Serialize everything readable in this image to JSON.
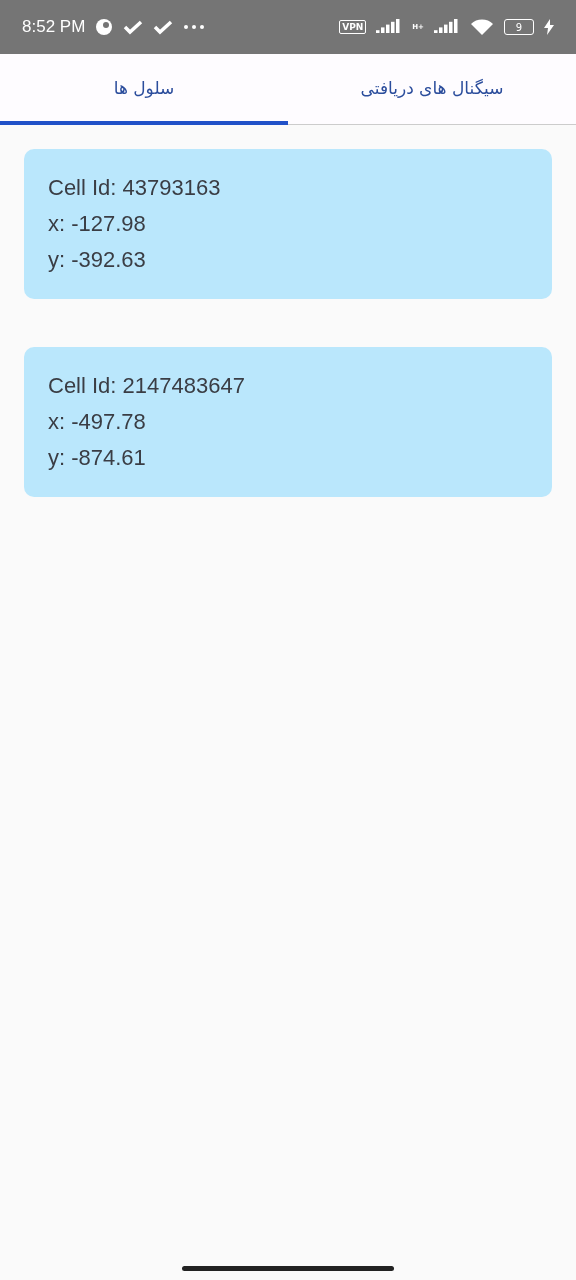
{
  "status_bar": {
    "time": "8:52 PM",
    "vpn": "VPN",
    "network": "H+",
    "battery": "9"
  },
  "tabs": [
    {
      "label": "سیگنال های دریافتی",
      "selected": false
    },
    {
      "label": "سلول ها",
      "selected": true
    }
  ],
  "cells": [
    {
      "lines": [
        "Cell Id: 43793163",
        "x: -127.98",
        "y: -392.63"
      ]
    },
    {
      "lines": [
        "Cell Id: 2147483647",
        "x: -497.78",
        "y: -874.61"
      ]
    }
  ]
}
